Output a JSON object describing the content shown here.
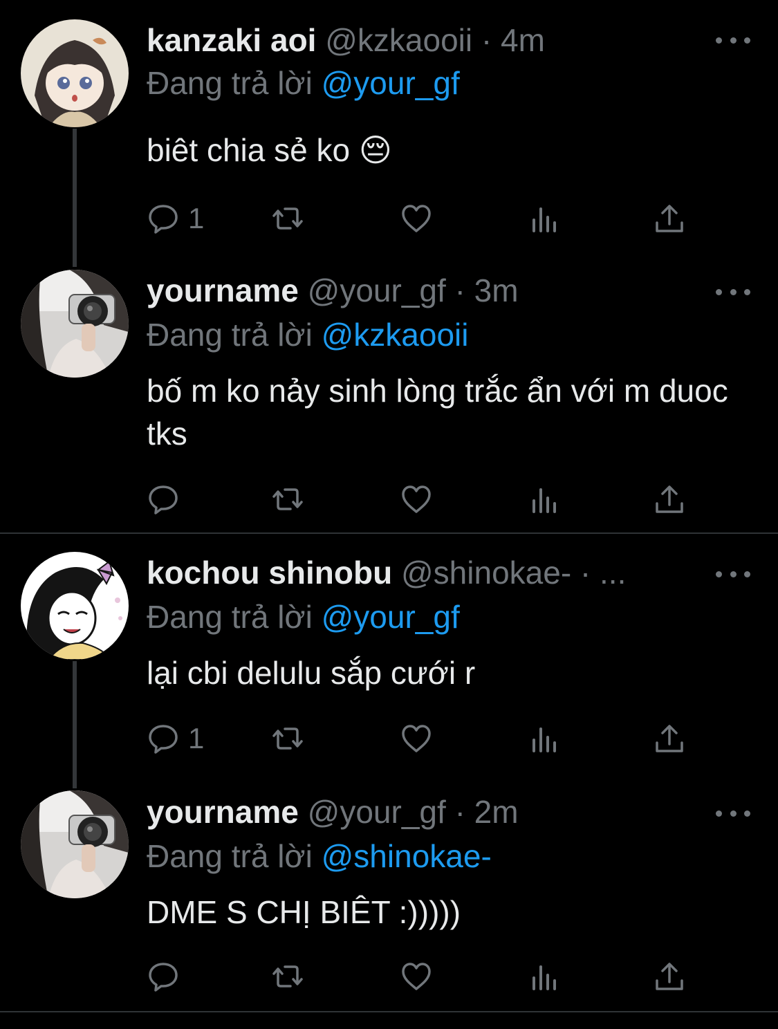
{
  "colors": {
    "background": "#000000",
    "text": "#e7e9ea",
    "muted": "#71767b",
    "link": "#1d9bf0",
    "divider": "#2f3336"
  },
  "icons": {
    "reply": "speech-bubble-icon",
    "retweet": "retweet-icon",
    "like": "heart-icon",
    "views": "bar-chart-icon",
    "share": "share-upload-icon",
    "more": "more-dots-icon"
  },
  "reply_prefix": "Đang trả lời",
  "tweets": [
    {
      "name": "kanzaki aoi",
      "handle": "@kzkaooii",
      "dot": "·",
      "time": "4m",
      "reply_to": "@your_gf",
      "text": "biêt chia sẻ ko 😔",
      "reply_count": "1"
    },
    {
      "name": "yourname",
      "handle": "@your_gf",
      "dot": "·",
      "time": "3m",
      "reply_to": "@kzkaooii",
      "text": "bố m ko nảy sinh lòng trắc ẩn với m duoc tks",
      "reply_count": ""
    },
    {
      "name": "kochou shinobu",
      "handle": "@shinokae-",
      "dot": "·",
      "time": "...",
      "reply_to": "@your_gf",
      "text": "lại cbi delulu sắp cưới r",
      "reply_count": "1"
    },
    {
      "name": "yourname",
      "handle": "@your_gf",
      "dot": "·",
      "time": "2m",
      "reply_to": "@shinokae-",
      "text": "DME S CHỊ BIÊT :)))))",
      "reply_count": ""
    }
  ]
}
